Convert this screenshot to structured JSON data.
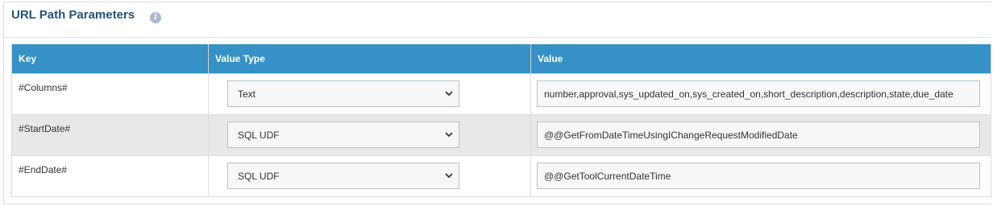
{
  "section": {
    "title": "URL Path Parameters",
    "info_icon": "info-icon"
  },
  "table": {
    "columns": [
      "Key",
      "Value Type",
      "Value"
    ],
    "rows": [
      {
        "key": "#Columns#",
        "value_type": "Text",
        "value": "number,approval,sys_updated_on,sys_created_on,short_description,description,state,due_date"
      },
      {
        "key": "#StartDate#",
        "value_type": "SQL UDF",
        "value": "@@GetFromDateTimeUsingIChangeRequestModifiedDate"
      },
      {
        "key": "#EndDate#",
        "value_type": "SQL UDF",
        "value": "@@GetToolCurrentDateTime"
      }
    ]
  },
  "colors": {
    "header_bg": "#3591c6",
    "title": "#23527c",
    "alt_row": "#e8e8e8"
  }
}
